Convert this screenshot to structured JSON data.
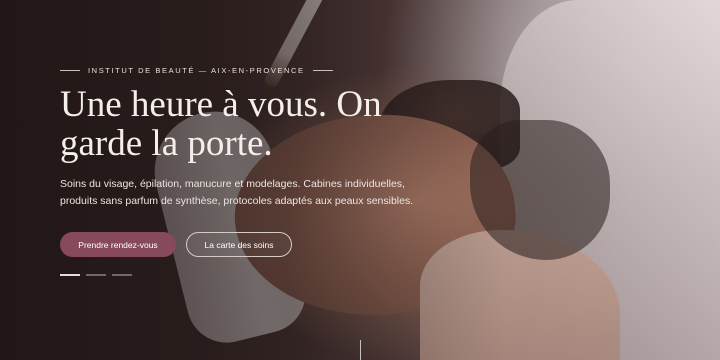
{
  "hero": {
    "eyebrow": "INSTITUT DE BEAUTÉ — AIX-EN-PROVENCE",
    "headline": "Une heure à vous. On garde la porte.",
    "subtext": "Soins du visage, épilation, manucure et modelages. Cabines individuelles, produits sans parfum de synthèse, protocoles adaptés aux peaux sensibles.",
    "primary_button": "Prendre rendez-vous",
    "secondary_button": "La carte des soins",
    "slides": 3,
    "active_slide": 1
  },
  "colors": {
    "primary": "#874a5b",
    "text_light": "#f5efec"
  }
}
